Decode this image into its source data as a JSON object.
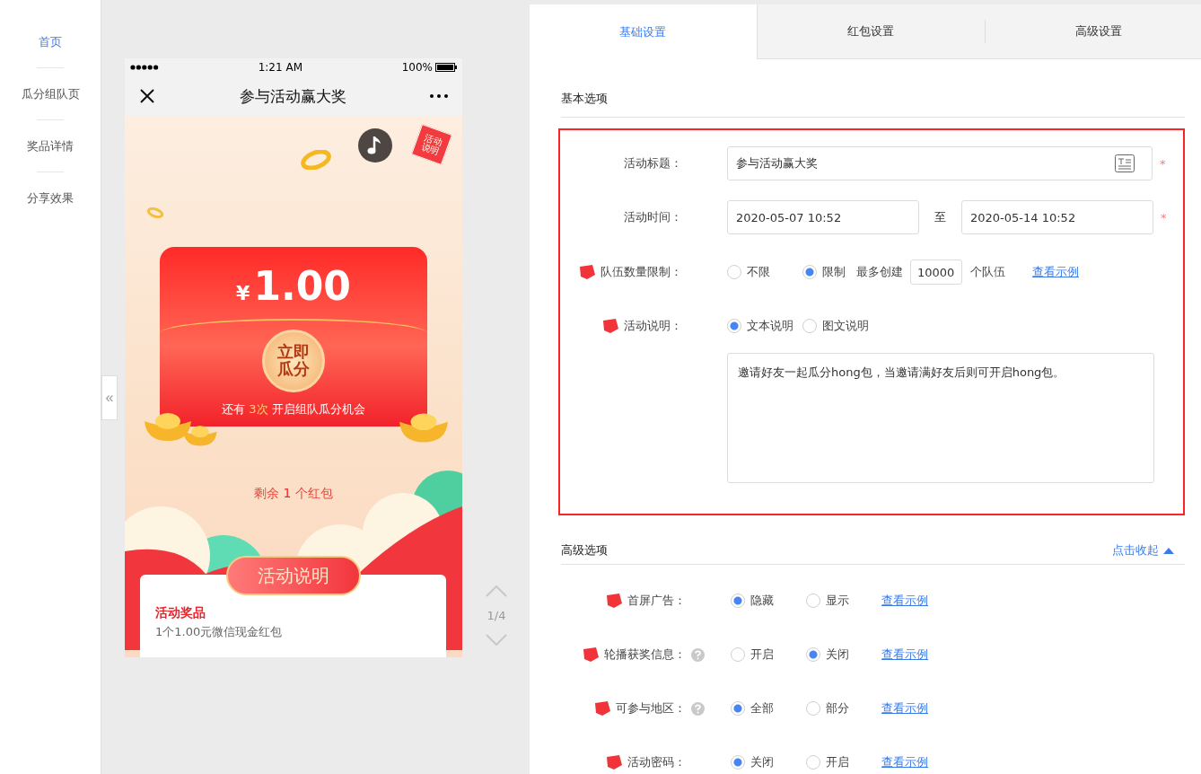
{
  "sidebar": {
    "items": [
      {
        "label": "首页",
        "selected": true
      },
      {
        "label": "瓜分组队页",
        "selected": false
      },
      {
        "label": "奖品详情",
        "selected": false
      },
      {
        "label": "分享效果",
        "selected": false
      }
    ]
  },
  "collapse_handle": "«",
  "phone": {
    "status_bar": {
      "time": "1:21 AM",
      "battery": "100%"
    },
    "nav": {
      "title": "参与活动赢大奖"
    },
    "hanging_tag": "活动说明",
    "amount": {
      "currency": "¥",
      "value": "1.00"
    },
    "open_button": [
      "立即",
      "瓜分"
    ],
    "chances": {
      "before": "还有 ",
      "highlight": "3次",
      "after": " 开启组队瓜分机会"
    },
    "remaining": {
      "before": "剩余 ",
      "highlight": "1",
      "after": " 个红包"
    },
    "rules_button": "活动说明",
    "card": {
      "heading": "活动奖品",
      "text": "1个1.00元微信现金红包"
    }
  },
  "pager": {
    "label": "1/4"
  },
  "tabs": [
    {
      "label": "基础设置",
      "selected": true
    },
    {
      "label": "红包设置",
      "selected": false
    },
    {
      "label": "高级设置",
      "selected": false
    }
  ],
  "basic": {
    "title": "基本选项",
    "activity_title": {
      "label": "活动标题：",
      "value": "参与活动赢大奖",
      "required_mark": "*"
    },
    "activity_time": {
      "label": "活动时间：",
      "start": "2020-05-07 10:52",
      "separator": "至",
      "end": "2020-05-14 10:52",
      "required_mark": "*"
    },
    "team_limit": {
      "label": "队伍数量限制：",
      "tagged": true,
      "options": [
        {
          "label": "不限",
          "selected": false
        },
        {
          "label": "限制",
          "selected": true
        }
      ],
      "max_label": "最多创建",
      "max_value": "10000",
      "unit": "个队伍",
      "link": "查看示例"
    },
    "description": {
      "label": "活动说明：",
      "tagged": true,
      "options": [
        {
          "label": "文本说明",
          "selected": true
        },
        {
          "label": "图文说明",
          "selected": false
        }
      ],
      "text": "邀请好友一起瓜分hong包，当邀请满好友后则可开启hong包。"
    }
  },
  "advanced": {
    "title": "高级选项",
    "toggle": "点击收起",
    "rows": [
      {
        "label": "首屏广告：",
        "tagged": true,
        "help": false,
        "options": [
          {
            "label": "隐藏",
            "selected": true
          },
          {
            "label": "显示",
            "selected": false
          }
        ],
        "link": "查看示例"
      },
      {
        "label": "轮播获奖信息：",
        "tagged": true,
        "help": true,
        "options": [
          {
            "label": "开启",
            "selected": false
          },
          {
            "label": "关闭",
            "selected": true
          }
        ],
        "link": "查看示例"
      },
      {
        "label": "可参与地区：",
        "tagged": true,
        "help": true,
        "options": [
          {
            "label": "全部",
            "selected": true
          },
          {
            "label": "部分",
            "selected": false
          }
        ],
        "link": "查看示例"
      },
      {
        "label": "活动密码：",
        "tagged": true,
        "help": false,
        "options": [
          {
            "label": "关闭",
            "selected": true
          },
          {
            "label": "开启",
            "selected": false
          }
        ],
        "link": "查看示例"
      }
    ]
  }
}
